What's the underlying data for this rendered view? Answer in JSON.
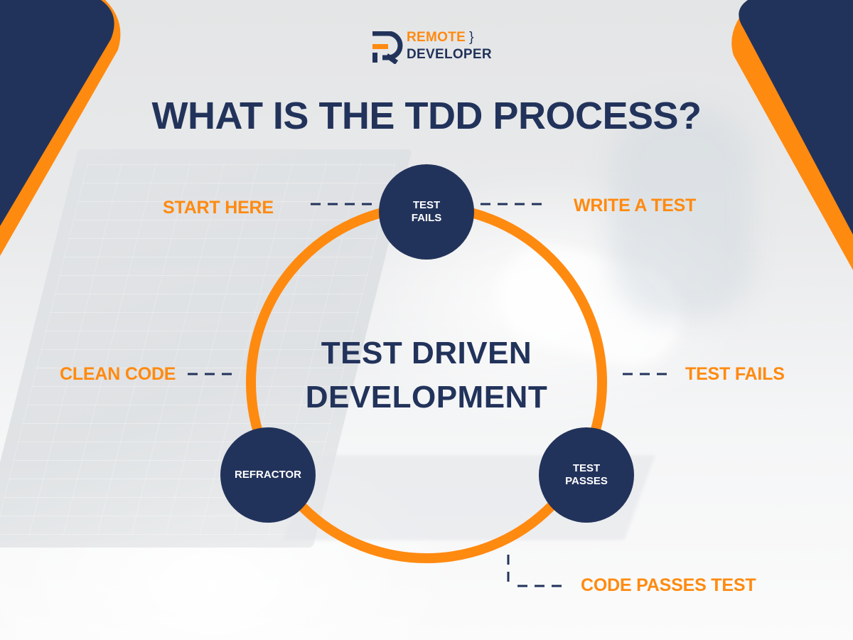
{
  "colors": {
    "navy": "#22335B",
    "orange": "#FF8A10",
    "background": "#EDEEEF",
    "white": "#FFFFFF"
  },
  "logo": {
    "line1": "REMOTE",
    "brace": "}",
    "line2": "DEVELOPER",
    "icon": "r-monogram-icon"
  },
  "title": "WHAT IS THE TDD PROCESS?",
  "center": {
    "line1": "TEST DRIVEN",
    "line2": "DEVELOPMENT"
  },
  "cycle_nodes": [
    {
      "id": "test-fails",
      "lines": [
        "TEST",
        "FAILS"
      ],
      "position": "top"
    },
    {
      "id": "test-passes",
      "lines": [
        "TEST",
        "PASSES"
      ],
      "position": "bottom-right"
    },
    {
      "id": "refractor",
      "lines": [
        "REFRACTOR"
      ],
      "position": "bottom-left"
    }
  ],
  "annotations": [
    {
      "id": "start-here",
      "text": "START HERE",
      "attached_to": "test-fails",
      "side": "left"
    },
    {
      "id": "write-a-test",
      "text": "WRITE A TEST",
      "attached_to": "test-fails",
      "side": "right"
    },
    {
      "id": "test-fails-label",
      "text": "TEST FAILS",
      "attached_to": "ring",
      "side": "right"
    },
    {
      "id": "code-passes-test",
      "text": "CODE PASSES TEST",
      "attached_to": "ring",
      "side": "bottom"
    },
    {
      "id": "clean-code",
      "text": "CLEAN CODE",
      "attached_to": "ring",
      "side": "left"
    }
  ]
}
